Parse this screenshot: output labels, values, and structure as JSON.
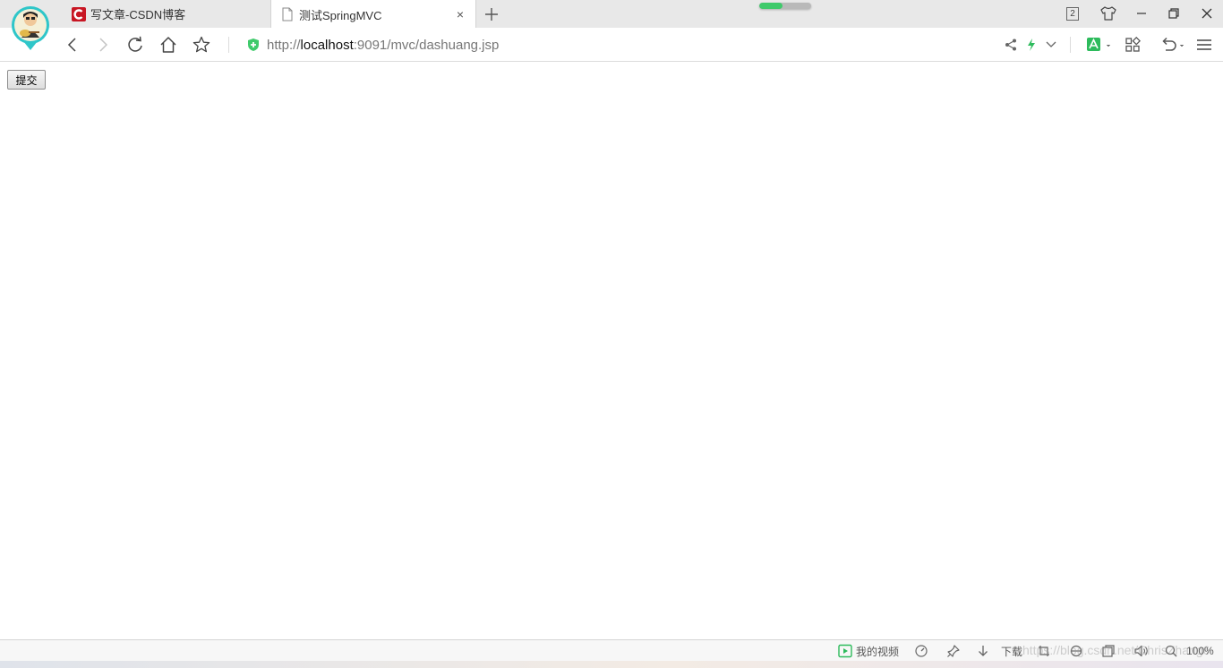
{
  "tabs": [
    {
      "title": "写文章-CSDN博客",
      "active": false,
      "favicon": "csdn-logo-icon"
    },
    {
      "title": "测试SpringMVC",
      "active": true,
      "favicon": "page-icon",
      "close": "×"
    }
  ],
  "window_controls": {
    "tab_count": "2"
  },
  "page_load_progress": 0.45,
  "address_bar": {
    "url_prefix": "http://",
    "url_host": "localhost",
    "url_rest": ":9091/mvc/dashuang.jsp",
    "security_icon": "green-shield-icon"
  },
  "page": {
    "submit_label": "提交"
  },
  "status_bar": {
    "my_video": "我的视频",
    "download": "下载",
    "zoom": "100%"
  },
  "watermark": "https://blog.csdn.net/ChrisZhang6",
  "colors": {
    "accent_green": "#3fca6b",
    "csdn_red": "#c81623"
  }
}
